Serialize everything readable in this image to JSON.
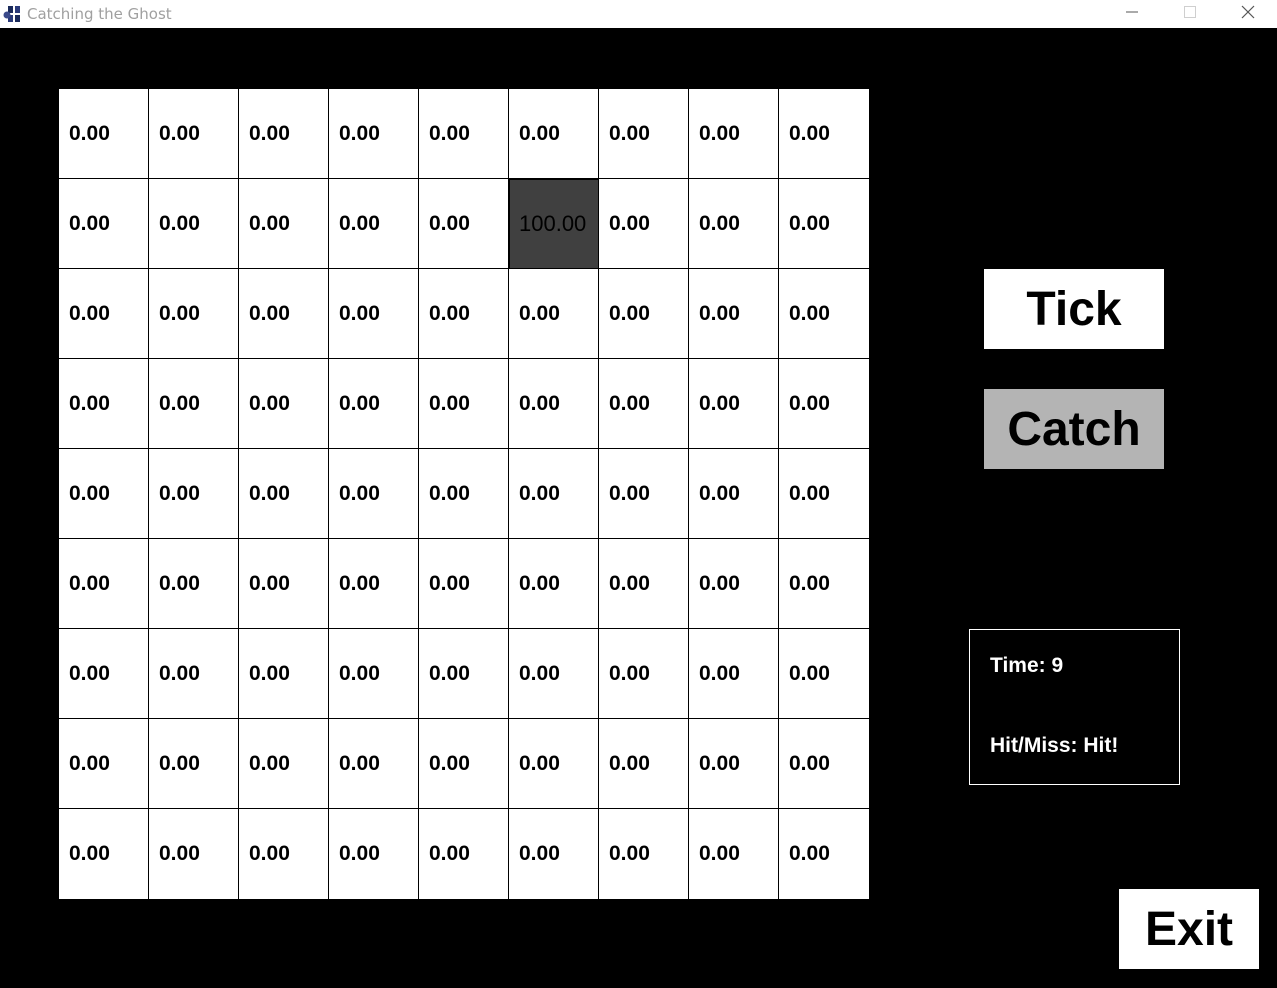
{
  "window": {
    "title": "Catching the Ghost",
    "icon": "app-ghost-icon"
  },
  "controls": {
    "minimize_icon": "minimize-icon",
    "maximize_icon": "maximize-icon",
    "close_icon": "close-icon"
  },
  "grid": {
    "rows": 9,
    "cols": 9,
    "ghost_cell": {
      "row": 1,
      "col": 5
    },
    "cells": [
      [
        "0.00",
        "0.00",
        "0.00",
        "0.00",
        "0.00",
        "0.00",
        "0.00",
        "0.00",
        "0.00"
      ],
      [
        "0.00",
        "0.00",
        "0.00",
        "0.00",
        "0.00",
        "100.00",
        "0.00",
        "0.00",
        "0.00"
      ],
      [
        "0.00",
        "0.00",
        "0.00",
        "0.00",
        "0.00",
        "0.00",
        "0.00",
        "0.00",
        "0.00"
      ],
      [
        "0.00",
        "0.00",
        "0.00",
        "0.00",
        "0.00",
        "0.00",
        "0.00",
        "0.00",
        "0.00"
      ],
      [
        "0.00",
        "0.00",
        "0.00",
        "0.00",
        "0.00",
        "0.00",
        "0.00",
        "0.00",
        "0.00"
      ],
      [
        "0.00",
        "0.00",
        "0.00",
        "0.00",
        "0.00",
        "0.00",
        "0.00",
        "0.00",
        "0.00"
      ],
      [
        "0.00",
        "0.00",
        "0.00",
        "0.00",
        "0.00",
        "0.00",
        "0.00",
        "0.00",
        "0.00"
      ],
      [
        "0.00",
        "0.00",
        "0.00",
        "0.00",
        "0.00",
        "0.00",
        "0.00",
        "0.00",
        "0.00"
      ],
      [
        "0.00",
        "0.00",
        "0.00",
        "0.00",
        "0.00",
        "0.00",
        "0.00",
        "0.00",
        "0.00"
      ]
    ]
  },
  "buttons": {
    "tick": "Tick",
    "catch": "Catch",
    "exit": "Exit"
  },
  "status": {
    "time": "Time: 9",
    "hit_miss": "Hit/Miss: Hit!"
  },
  "colors": {
    "background": "#000000",
    "cell": "#ffffff",
    "ghost_cell": "#404040",
    "catch_button": "#b4b4b4"
  }
}
